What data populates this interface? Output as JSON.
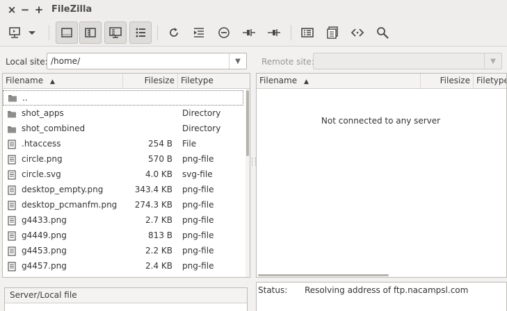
{
  "window": {
    "title": "FileZilla",
    "close": "×",
    "minimize": "−",
    "maximize": "+"
  },
  "toolbar": {
    "buttons": [
      {
        "name": "site-manager-icon"
      },
      {
        "name": "dropdown-arrow-icon"
      },
      {
        "name": "toggle-message-log-icon"
      },
      {
        "name": "toggle-local-tree-icon"
      },
      {
        "name": "toggle-remote-tree-icon"
      },
      {
        "name": "toggle-transfer-queue-icon"
      },
      {
        "name": "refresh-icon"
      },
      {
        "name": "process-queue-icon"
      },
      {
        "name": "cancel-icon"
      },
      {
        "name": "disconnect-icon"
      },
      {
        "name": "reconnect-icon"
      },
      {
        "name": "directory-listing-filters-icon"
      },
      {
        "name": "compare-directories-icon"
      },
      {
        "name": "sync-browsing-icon"
      },
      {
        "name": "search-icon"
      }
    ]
  },
  "local": {
    "site_label": "Local site:",
    "path": "/home/",
    "columns": {
      "filename": "Filename",
      "filesize": "Filesize",
      "filetype": "Filetype"
    },
    "files": [
      {
        "name": "..",
        "size": "",
        "type": "",
        "kind": "folder"
      },
      {
        "name": "shot_apps",
        "size": "",
        "type": "Directory",
        "kind": "folder"
      },
      {
        "name": "shot_combined",
        "size": "",
        "type": "Directory",
        "kind": "folder"
      },
      {
        "name": ".htaccess",
        "size": "254 B",
        "type": "File",
        "kind": "file"
      },
      {
        "name": "circle.png",
        "size": "570 B",
        "type": "png-file",
        "kind": "file"
      },
      {
        "name": "circle.svg",
        "size": "4.0 KB",
        "type": "svg-file",
        "kind": "file"
      },
      {
        "name": "desktop_empty.png",
        "size": "343.4 KB",
        "type": "png-file",
        "kind": "file"
      },
      {
        "name": "desktop_pcmanfm.png",
        "size": "274.3 KB",
        "type": "png-file",
        "kind": "file"
      },
      {
        "name": "g4433.png",
        "size": "2.7 KB",
        "type": "png-file",
        "kind": "file"
      },
      {
        "name": "g4449.png",
        "size": "813 B",
        "type": "png-file",
        "kind": "file"
      },
      {
        "name": "g4453.png",
        "size": "2.2 KB",
        "type": "png-file",
        "kind": "file"
      },
      {
        "name": "g4457.png",
        "size": "2.4 KB",
        "type": "png-file",
        "kind": "file"
      }
    ]
  },
  "remote": {
    "site_label": "Remote site:",
    "path": "",
    "columns": {
      "filename": "Filename",
      "filesize": "Filesize",
      "filetype": "Filetype"
    },
    "empty_message": "Not connected to any server"
  },
  "queue": {
    "column": "Server/Local file"
  },
  "log": {
    "label": "Status:",
    "message": "Resolving address of ftp.nacampsl.com"
  }
}
